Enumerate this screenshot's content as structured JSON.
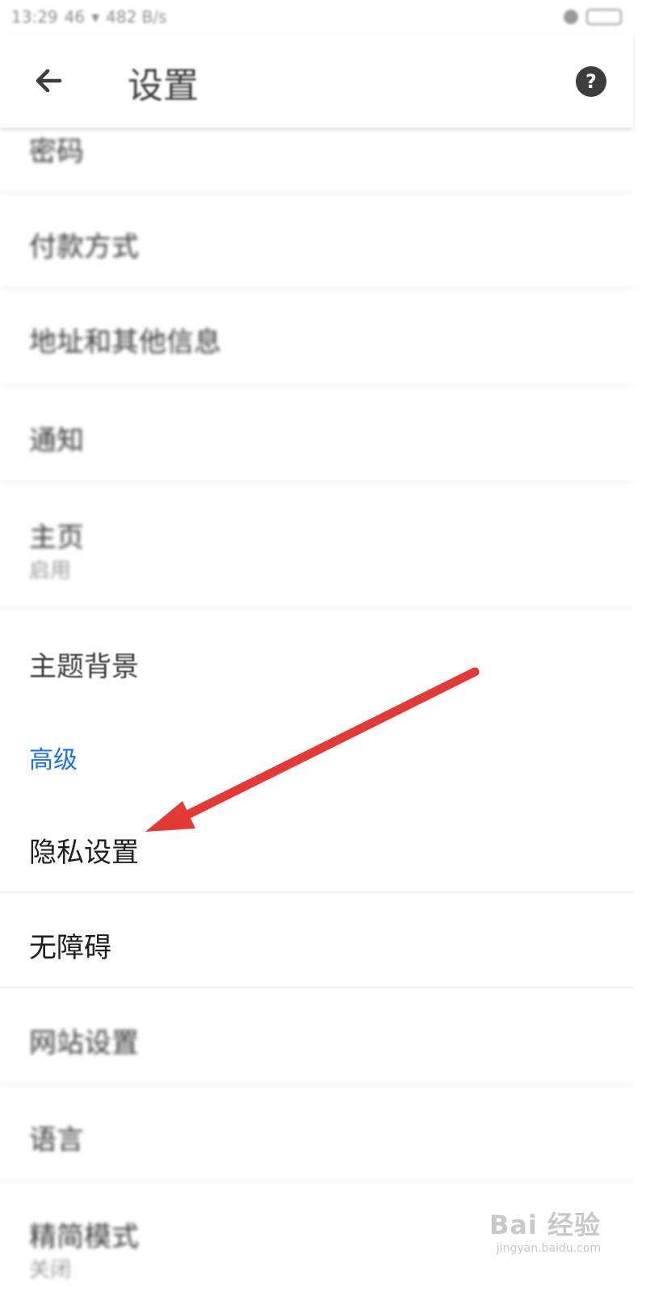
{
  "status_bar": {
    "time": "13:29",
    "network": "46",
    "speed": "482 B/s"
  },
  "header": {
    "title": "设置",
    "back_icon": "arrow-left-icon",
    "help_icon": "help-circle-icon"
  },
  "settings": {
    "items": [
      {
        "label": "密码"
      },
      {
        "label": "付款方式"
      },
      {
        "label": "地址和其他信息"
      },
      {
        "label": "通知"
      },
      {
        "label": "主页",
        "sub": "启用"
      },
      {
        "label": "主题背景"
      },
      {
        "label": "隐私设置"
      },
      {
        "label": "无障碍"
      },
      {
        "label": "网站设置"
      },
      {
        "label": "语言"
      },
      {
        "label": "精简模式",
        "sub": "关闭"
      }
    ],
    "section_advanced": "高级"
  },
  "annotation": {
    "arrow_color": "#e53935"
  },
  "watermark": {
    "logo": "Bai 经验",
    "url": "jingyan.baidu.com"
  },
  "colors": {
    "accent": "#1a73e8",
    "divider": "#eeeeee"
  }
}
